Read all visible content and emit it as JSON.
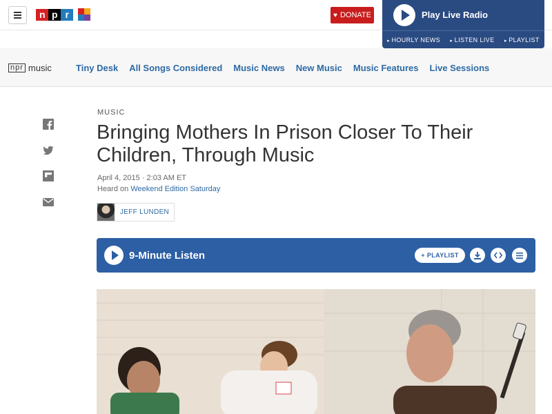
{
  "header": {
    "logo_letters": [
      "n",
      "p",
      "r"
    ],
    "donate_label": "DONATE",
    "radio": {
      "title": "Play Live Radio",
      "links": [
        "HOURLY NEWS",
        "LISTEN LIVE",
        "PLAYLIST"
      ]
    }
  },
  "music_nav": {
    "logo_box": "npr",
    "logo_word": "music",
    "links": [
      "Tiny Desk",
      "All Songs Considered",
      "Music News",
      "New Music",
      "Music Features",
      "Live Sessions"
    ]
  },
  "share": {
    "icons": [
      "facebook-icon",
      "twitter-icon",
      "flipboard-icon",
      "email-icon"
    ]
  },
  "article": {
    "kicker": "Music",
    "title": "Bringing Mothers In Prison Closer To Their Children, Through Music",
    "date": "April 4, 2015 · 2:03 AM ET",
    "heard_on_prefix": "Heard on ",
    "heard_on_show": "Weekend Edition Saturday",
    "author": "JEFF LUNDEN"
  },
  "player": {
    "title": "9-Minute Listen",
    "playlist_label": "PLAYLIST",
    "playlist_prefix": "+"
  },
  "colors": {
    "npr_red": "#d62021",
    "npr_black": "#000000",
    "npr_blue": "#237bbd",
    "donate": "#c91d1d",
    "radio_panel": "#2a4a82",
    "player": "#2d5fa4",
    "link": "#2d6aa5"
  }
}
